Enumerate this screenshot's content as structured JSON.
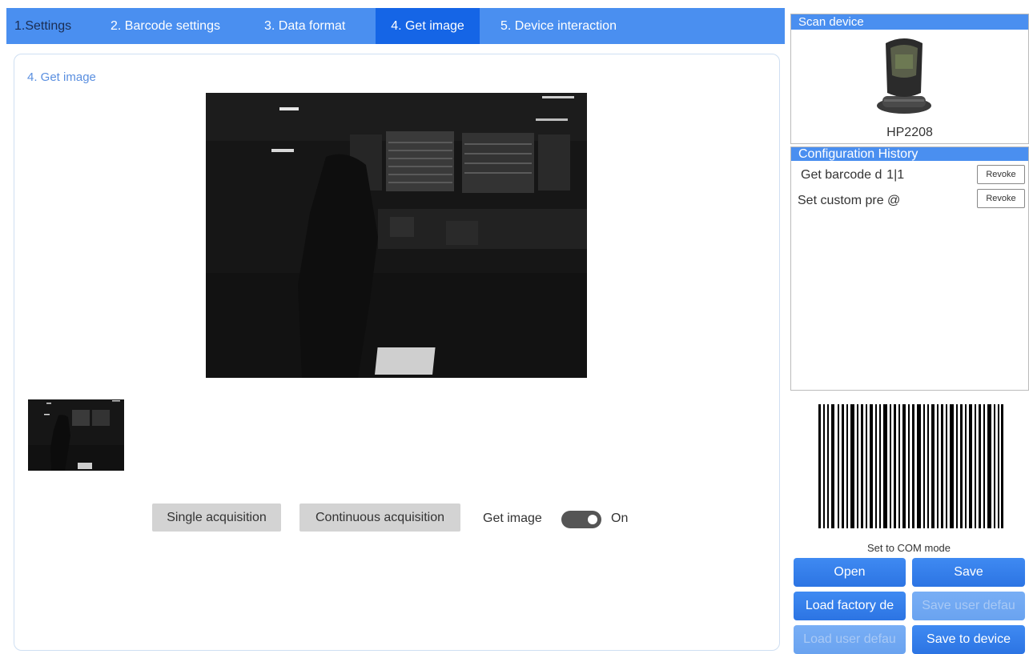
{
  "tabs": [
    {
      "label": "1.Settings"
    },
    {
      "label": "2. Barcode settings"
    },
    {
      "label": "3. Data format"
    },
    {
      "label": "4. Get image"
    },
    {
      "label": "5. Device interaction"
    }
  ],
  "active_tab": "4. Get image",
  "panel": {
    "title": "4. Get image",
    "buttons": {
      "single": "Single acquisition",
      "continuous": "Continuous acquisition"
    },
    "get_image": {
      "label": "Get image",
      "state": "On"
    }
  },
  "scan_device": {
    "header": "Scan device",
    "model": "HP2208"
  },
  "config_history": {
    "header": "Configuration History",
    "items": [
      {
        "text": "Get barcode d  1|1",
        "action": "Revoke"
      },
      {
        "text": "Set custom pre @",
        "action": "Revoke"
      }
    ]
  },
  "barcode_caption": "Set to COM mode",
  "actions": {
    "open": "Open",
    "save": "Save",
    "load_factory": "Load factory de",
    "save_user": "Save user defau",
    "load_user": "Load user defau",
    "save_device": "Save to device"
  },
  "colors": {
    "tab_bar": "#4a8ff0",
    "tab_active": "#1565e6",
    "panel_title": "#5a8fe0",
    "button_blue": "#2c74e3"
  }
}
